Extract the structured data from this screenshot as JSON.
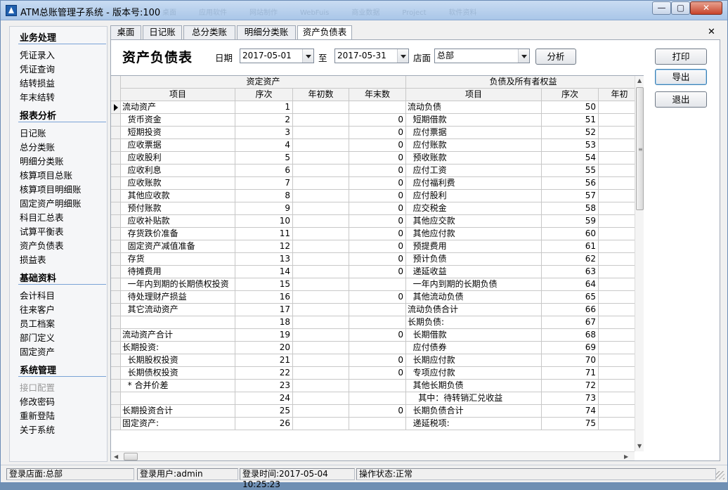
{
  "window": {
    "title": "ATM总账管理子系统 - 版本号:100",
    "ghost_tabs": [
      "桌面",
      "应用软件",
      "网站制作",
      "WebFuis",
      "商业数据",
      "Project",
      "软件资料"
    ],
    "minimize": "—",
    "maximize": "▢",
    "close": "✕"
  },
  "sidebar": {
    "sections": [
      {
        "title": "业务处理",
        "items": [
          {
            "label": "凭证录入",
            "enabled": true
          },
          {
            "label": "凭证查询",
            "enabled": true
          },
          {
            "label": "结转损益",
            "enabled": true
          },
          {
            "label": "年末结转",
            "enabled": true
          }
        ]
      },
      {
        "title": "报表分析",
        "items": [
          {
            "label": "日记账",
            "enabled": true
          },
          {
            "label": "总分类账",
            "enabled": true
          },
          {
            "label": "明细分类账",
            "enabled": true
          },
          {
            "label": "核算项目总账",
            "enabled": true
          },
          {
            "label": "核算项目明细账",
            "enabled": true
          },
          {
            "label": "固定资产明细账",
            "enabled": true
          },
          {
            "label": "科目汇总表",
            "enabled": true
          },
          {
            "label": "试算平衡表",
            "enabled": true
          },
          {
            "label": "资产负债表",
            "enabled": true
          },
          {
            "label": "损益表",
            "enabled": true
          }
        ]
      },
      {
        "title": "基础资料",
        "items": [
          {
            "label": "会计科目",
            "enabled": true
          },
          {
            "label": "往来客户",
            "enabled": true
          },
          {
            "label": "员工档案",
            "enabled": true
          },
          {
            "label": "部门定义",
            "enabled": true
          },
          {
            "label": "固定资产",
            "enabled": true
          }
        ]
      },
      {
        "title": "系统管理",
        "items": [
          {
            "label": "接口配置",
            "enabled": false
          },
          {
            "label": "修改密码",
            "enabled": true
          },
          {
            "label": "重新登陆",
            "enabled": true
          },
          {
            "label": "关于系统",
            "enabled": true
          }
        ]
      }
    ]
  },
  "tabs": [
    {
      "label": "桌面",
      "active": false
    },
    {
      "label": "日记账",
      "active": false
    },
    {
      "label": "总分类账",
      "active": false
    },
    {
      "label": "明细分类账",
      "active": false
    },
    {
      "label": "资产负债表",
      "active": true
    }
  ],
  "tab_close": "✕",
  "report": {
    "title": "资产负债表",
    "date_label": "日期",
    "date_from": "2017-05-01",
    "to_label": "至",
    "date_to": "2017-05-31",
    "store_label": "店面",
    "store": "总部",
    "analyze_button": "分析"
  },
  "actions": {
    "print": "打印",
    "export": "导出",
    "exit": "退出"
  },
  "grid": {
    "group_left": "资定资产",
    "group_right": "负债及所有者权益",
    "columns": [
      "项目",
      "序次",
      "年初数",
      "年末数",
      "项目",
      "序次",
      "年初"
    ],
    "rows": [
      {
        "l_item": "流动资产",
        "l_seq": "1",
        "l_begin": "",
        "l_end": "",
        "r_item": "流动负债",
        "r_seq": "50"
      },
      {
        "l_item": "  货币资金",
        "l_seq": "2",
        "l_begin": "",
        "l_end": "0",
        "r_item": "  短期借款",
        "r_seq": "51"
      },
      {
        "l_item": "  短期投资",
        "l_seq": "3",
        "l_begin": "",
        "l_end": "0",
        "r_item": "  应付票据",
        "r_seq": "52"
      },
      {
        "l_item": "  应收票据",
        "l_seq": "4",
        "l_begin": "",
        "l_end": "0",
        "r_item": "  应付账款",
        "r_seq": "53"
      },
      {
        "l_item": "  应收股利",
        "l_seq": "5",
        "l_begin": "",
        "l_end": "0",
        "r_item": "  预收账款",
        "r_seq": "54"
      },
      {
        "l_item": "  应收利息",
        "l_seq": "6",
        "l_begin": "",
        "l_end": "0",
        "r_item": "  应付工资",
        "r_seq": "55"
      },
      {
        "l_item": "  应收账款",
        "l_seq": "7",
        "l_begin": "",
        "l_end": "0",
        "r_item": "  应付福利费",
        "r_seq": "56"
      },
      {
        "l_item": "  其他应收款",
        "l_seq": "8",
        "l_begin": "",
        "l_end": "0",
        "r_item": "  应付股利",
        "r_seq": "57"
      },
      {
        "l_item": "  预付账款",
        "l_seq": "9",
        "l_begin": "",
        "l_end": "0",
        "r_item": "  应交税金",
        "r_seq": "58"
      },
      {
        "l_item": "  应收补贴款",
        "l_seq": "10",
        "l_begin": "",
        "l_end": "0",
        "r_item": "  其他应交款",
        "r_seq": "59"
      },
      {
        "l_item": "  存货跌价准备",
        "l_seq": "11",
        "l_begin": "",
        "l_end": "0",
        "r_item": "  其他应付款",
        "r_seq": "60"
      },
      {
        "l_item": "  固定资产减值准备",
        "l_seq": "12",
        "l_begin": "",
        "l_end": "0",
        "r_item": "  预提费用",
        "r_seq": "61"
      },
      {
        "l_item": "  存货",
        "l_seq": "13",
        "l_begin": "",
        "l_end": "0",
        "r_item": "  预计负债",
        "r_seq": "62"
      },
      {
        "l_item": "  待摊费用",
        "l_seq": "14",
        "l_begin": "",
        "l_end": "0",
        "r_item": "  递延收益",
        "r_seq": "63"
      },
      {
        "l_item": "  一年内到期的长期债权投资",
        "l_seq": "15",
        "l_begin": "",
        "l_end": "",
        "r_item": "  一年内到期的长期负债",
        "r_seq": "64"
      },
      {
        "l_item": "  待处理财产损益",
        "l_seq": "16",
        "l_begin": "",
        "l_end": "0",
        "r_item": "  其他流动负债",
        "r_seq": "65"
      },
      {
        "l_item": "  其它流动资产",
        "l_seq": "17",
        "l_begin": "",
        "l_end": "",
        "r_item": "流动负债合计",
        "r_seq": "66"
      },
      {
        "l_item": "",
        "l_seq": "18",
        "l_begin": "",
        "l_end": "",
        "r_item": "长期负债:",
        "r_seq": "67"
      },
      {
        "l_item": "流动资产合计",
        "l_seq": "19",
        "l_begin": "",
        "l_end": "0",
        "r_item": "  长期借款",
        "r_seq": "68"
      },
      {
        "l_item": "长期投资:",
        "l_seq": "20",
        "l_begin": "",
        "l_end": "",
        "r_item": "  应付债券",
        "r_seq": "69"
      },
      {
        "l_item": "  长期股权投资",
        "l_seq": "21",
        "l_begin": "",
        "l_end": "0",
        "r_item": "  长期应付款",
        "r_seq": "70"
      },
      {
        "l_item": "  长期债权投资",
        "l_seq": "22",
        "l_begin": "",
        "l_end": "0",
        "r_item": "  专项应付款",
        "r_seq": "71"
      },
      {
        "l_item": "  * 合并价差",
        "l_seq": "23",
        "l_begin": "",
        "l_end": "",
        "r_item": "  其他长期负债",
        "r_seq": "72"
      },
      {
        "l_item": "",
        "l_seq": "24",
        "l_begin": "",
        "l_end": "",
        "r_item": "    其中：待转销汇兑收益",
        "r_seq": "73"
      },
      {
        "l_item": "长期投资合计",
        "l_seq": "25",
        "l_begin": "",
        "l_end": "0",
        "r_item": "  长期负债合计",
        "r_seq": "74"
      },
      {
        "l_item": "固定资产:",
        "l_seq": "26",
        "l_begin": "",
        "l_end": "",
        "r_item": "  递延税项:",
        "r_seq": "75"
      }
    ]
  },
  "status": {
    "store": "登录店面:总部",
    "user": "登录用户:admin",
    "login_time": "登录时间:2017-05-04 10:25:23",
    "op_status": "操作状态:正常"
  }
}
